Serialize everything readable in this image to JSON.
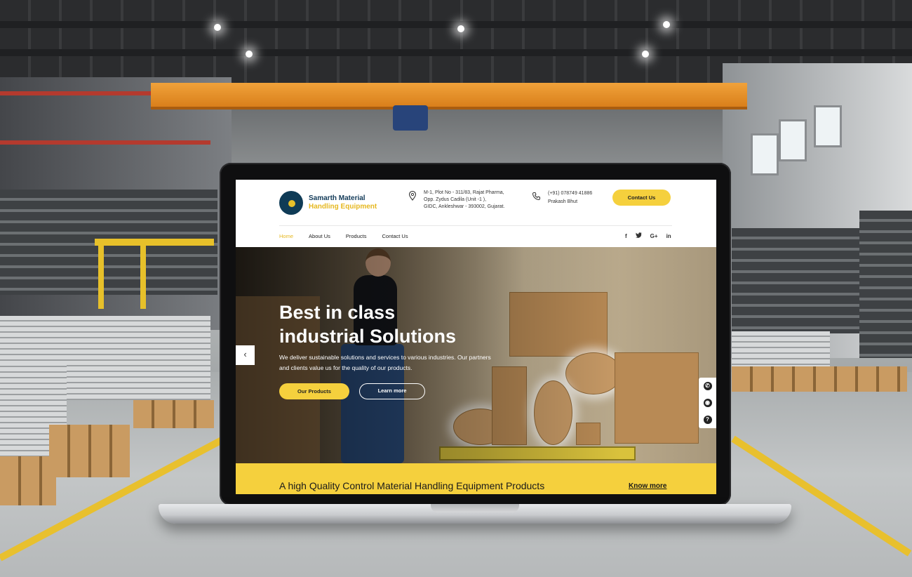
{
  "brand": {
    "line1": "Samarth Material",
    "line2": "Handling Equipment"
  },
  "address": {
    "line1": "M-1, Plot No - 311/83, Rajat Pharma,",
    "line2": "Opp. Zydus Cadila (Unit -1 ),",
    "line3": "GIDC, Ankleshwar - 393002, Gujarat."
  },
  "phone": {
    "number": "(+91) 078749 41886",
    "name": "Prakash Bhut"
  },
  "header": {
    "contact_button": "Contact Us"
  },
  "nav": {
    "items": [
      {
        "label": "Home",
        "active": true
      },
      {
        "label": "About Us",
        "active": false
      },
      {
        "label": "Products",
        "active": false
      },
      {
        "label": "Contact Us",
        "active": false
      }
    ]
  },
  "social": {
    "facebook": "f",
    "twitter": "🐦",
    "google": "G+",
    "linkedin": "in"
  },
  "hero": {
    "title_line1": "Best in class",
    "title_line2": "industrial Solutions",
    "subtitle_line1": "We deliver sustainable solutions and services to various industries. Our partners",
    "subtitle_line2": "and clients value us for the quality of our products.",
    "primary_button": "Our Products",
    "secondary_button": "Learn more",
    "prev_arrow": "‹"
  },
  "floating": {
    "phone_icon": "✆",
    "whatsapp_icon": "◉",
    "help_icon": "?"
  },
  "banner": {
    "text": "A high Quality Control Material Handling Equipment Products",
    "link": "Know more"
  },
  "colors": {
    "accent_yellow": "#f5d03d",
    "brand_navy": "#123a58",
    "brand_gold": "#e6b820"
  }
}
